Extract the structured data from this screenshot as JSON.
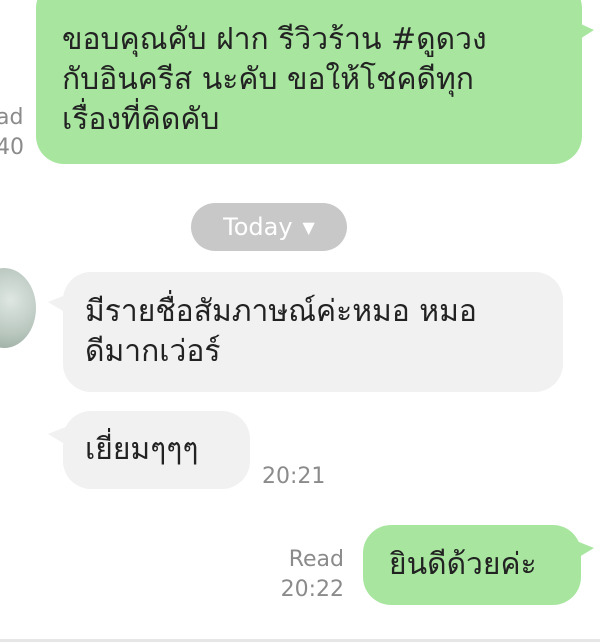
{
  "messages": {
    "m1": {
      "line1": " ขอบคุณคับ ฝาก รีวิวร้าน #ดูดวง",
      "line2": "กับอินครีส นะคับ ขอให้โชคดีทุก",
      "line3": "เรื่องที่คิดคับ",
      "meta_status": "ad",
      "meta_time": "40"
    },
    "m2": {
      "line1": "มีรายชื่อสัมภาษณ์ค่ะหมอ หมอ",
      "line2": "ดีมากเว่อร์"
    },
    "m3": {
      "text": "เยี่ยมๆๆๆ",
      "time": "20:21"
    },
    "m4": {
      "text": "ยินดีด้วยค่ะ",
      "status": "Read",
      "time": "20:22"
    }
  },
  "date_divider": {
    "label": "Today",
    "icon": "chevron-down-icon"
  },
  "colors": {
    "outgoing_bubble": "#a8e6a0",
    "incoming_bubble": "#f1f1f1",
    "date_pill": "#c8c8c8",
    "meta_text": "#8b8b8b"
  }
}
